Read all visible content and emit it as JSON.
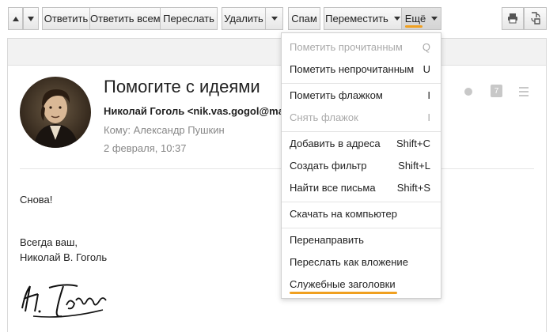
{
  "toolbar": {
    "reply": "Ответить",
    "reply_all": "Ответить всем",
    "forward": "Переслать",
    "delete": "Удалить",
    "spam": "Спам",
    "move": "Переместить",
    "more": "Ещё"
  },
  "message": {
    "subject": "Помогите с идеями",
    "from": "Николай Гоголь <nik.vas.gogol@mail.ru>",
    "to": "Кому: Александр Пушкин",
    "date": "2 февраля, 10:37",
    "body": {
      "line1": "Снова!",
      "line2": "Всегда ваш,",
      "line3": "Николай В. Гоголь"
    },
    "calendar_day": "7"
  },
  "menu": {
    "items": [
      {
        "label": "Пометить прочитанным",
        "shortcut": "Q",
        "disabled": true
      },
      {
        "label": "Пометить непрочитанным",
        "shortcut": "U",
        "disabled": false
      },
      {
        "label": "Пометить флажком",
        "shortcut": "I",
        "disabled": false
      },
      {
        "label": "Снять флажок",
        "shortcut": "I",
        "disabled": true
      },
      {
        "label": "Добавить в адреса",
        "shortcut": "Shift+C",
        "disabled": false
      },
      {
        "label": "Создать фильтр",
        "shortcut": "Shift+L",
        "disabled": false
      },
      {
        "label": "Найти все письма",
        "shortcut": "Shift+S",
        "disabled": false
      },
      {
        "label": "Скачать на компьютер",
        "shortcut": "",
        "disabled": false
      },
      {
        "label": "Перенаправить",
        "shortcut": "",
        "disabled": false
      },
      {
        "label": "Переслать как вложение",
        "shortcut": "",
        "disabled": false
      },
      {
        "label": "Служебные заголовки",
        "shortcut": "",
        "disabled": false
      }
    ]
  },
  "colors": {
    "highlight": "#f0a020",
    "disabled_text": "#aaaaaa",
    "meta_text": "#888888"
  },
  "icons": [
    "arrow-up-icon",
    "arrow-down-icon",
    "caret-down-icon",
    "print-icon",
    "translate-icon",
    "dot-icon",
    "calendar-icon",
    "menu-lines-icon"
  ]
}
